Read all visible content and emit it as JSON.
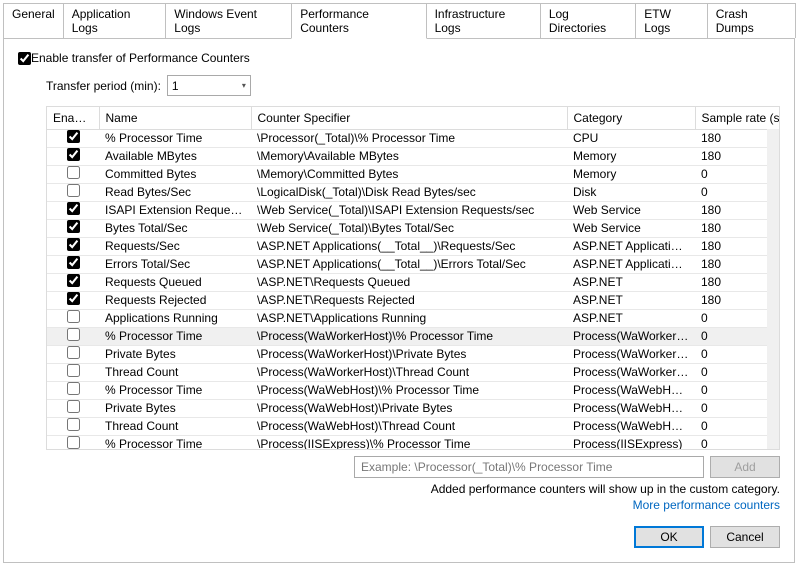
{
  "tabs": [
    "General",
    "Application Logs",
    "Windows Event Logs",
    "Performance Counters",
    "Infrastructure Logs",
    "Log Directories",
    "ETW Logs",
    "Crash Dumps"
  ],
  "activeTab": 3,
  "enableLabel": "Enable transfer of Performance Counters",
  "enableChecked": true,
  "transferLabel": "Transfer period (min):",
  "transferValue": "1",
  "columns": {
    "enabled": "Enabled",
    "name": "Name",
    "spec": "Counter Specifier",
    "cat": "Category",
    "rate": "Sample rate (sec)"
  },
  "rows": [
    {
      "enabled": true,
      "name": "% Processor Time",
      "spec": "\\Processor(_Total)\\% Processor Time",
      "cat": "CPU",
      "rate": "180"
    },
    {
      "enabled": true,
      "name": "Available MBytes",
      "spec": "\\Memory\\Available MBytes",
      "cat": "Memory",
      "rate": "180"
    },
    {
      "enabled": false,
      "name": "Committed Bytes",
      "spec": "\\Memory\\Committed Bytes",
      "cat": "Memory",
      "rate": "0"
    },
    {
      "enabled": false,
      "name": "Read Bytes/Sec",
      "spec": "\\LogicalDisk(_Total)\\Disk Read Bytes/sec",
      "cat": "Disk",
      "rate": "0"
    },
    {
      "enabled": true,
      "name": "ISAPI Extension Requests/...",
      "spec": "\\Web Service(_Total)\\ISAPI Extension Requests/sec",
      "cat": "Web Service",
      "rate": "180"
    },
    {
      "enabled": true,
      "name": "Bytes Total/Sec",
      "spec": "\\Web Service(_Total)\\Bytes Total/Sec",
      "cat": "Web Service",
      "rate": "180"
    },
    {
      "enabled": true,
      "name": "Requests/Sec",
      "spec": "\\ASP.NET Applications(__Total__)\\Requests/Sec",
      "cat": "ASP.NET Applications",
      "rate": "180"
    },
    {
      "enabled": true,
      "name": "Errors Total/Sec",
      "spec": "\\ASP.NET Applications(__Total__)\\Errors Total/Sec",
      "cat": "ASP.NET Applications",
      "rate": "180"
    },
    {
      "enabled": true,
      "name": "Requests Queued",
      "spec": "\\ASP.NET\\Requests Queued",
      "cat": "ASP.NET",
      "rate": "180"
    },
    {
      "enabled": true,
      "name": "Requests Rejected",
      "spec": "\\ASP.NET\\Requests Rejected",
      "cat": "ASP.NET",
      "rate": "180"
    },
    {
      "enabled": false,
      "name": "Applications Running",
      "spec": "\\ASP.NET\\Applications Running",
      "cat": "ASP.NET",
      "rate": "0"
    },
    {
      "enabled": false,
      "name": "% Processor Time",
      "spec": "\\Process(WaWorkerHost)\\% Processor Time",
      "cat": "Process(WaWorkerHost)",
      "rate": "0",
      "sel": true
    },
    {
      "enabled": false,
      "name": "Private Bytes",
      "spec": "\\Process(WaWorkerHost)\\Private Bytes",
      "cat": "Process(WaWorkerHost)",
      "rate": "0"
    },
    {
      "enabled": false,
      "name": "Thread Count",
      "spec": "\\Process(WaWorkerHost)\\Thread Count",
      "cat": "Process(WaWorkerHost)",
      "rate": "0"
    },
    {
      "enabled": false,
      "name": "% Processor Time",
      "spec": "\\Process(WaWebHost)\\% Processor Time",
      "cat": "Process(WaWebHost)",
      "rate": "0"
    },
    {
      "enabled": false,
      "name": "Private Bytes",
      "spec": "\\Process(WaWebHost)\\Private Bytes",
      "cat": "Process(WaWebHost)",
      "rate": "0"
    },
    {
      "enabled": false,
      "name": "Thread Count",
      "spec": "\\Process(WaWebHost)\\Thread Count",
      "cat": "Process(WaWebHost)",
      "rate": "0"
    },
    {
      "enabled": false,
      "name": "% Processor Time",
      "spec": "\\Process(IISExpress)\\% Processor Time",
      "cat": "Process(IISExpress)",
      "rate": "0"
    }
  ],
  "examplePlaceholder": "Example: \\Processor(_Total)\\% Processor Time",
  "addLabel": "Add",
  "hintText": "Added performance counters will show up in the custom category.",
  "linkText": "More performance counters",
  "okLabel": "OK",
  "cancelLabel": "Cancel"
}
